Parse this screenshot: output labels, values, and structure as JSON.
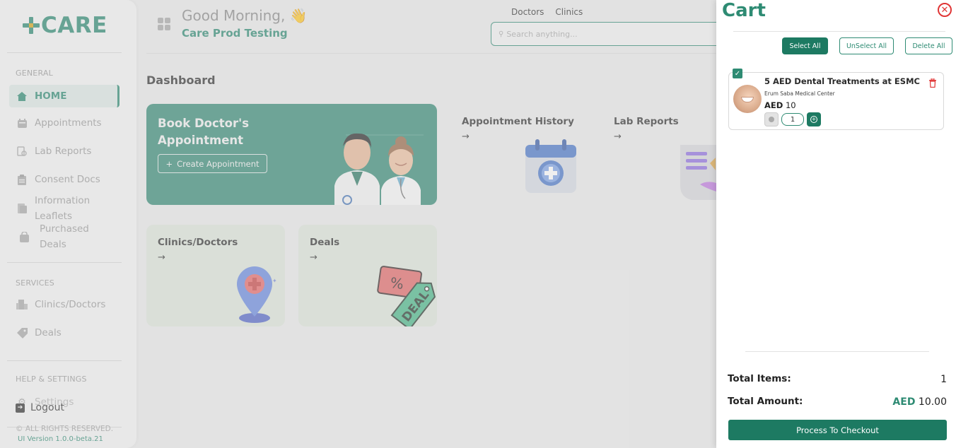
{
  "sidebar": {
    "logo_text": "CARE",
    "general_title": "GENERAL",
    "items": [
      {
        "label": "HOME",
        "icon": "home-icon"
      },
      {
        "label": "Appointments",
        "icon": "calendar-icon"
      },
      {
        "label": "Lab Reports",
        "icon": "lab-icon"
      },
      {
        "label": "Consent Docs",
        "icon": "clipboard-icon"
      },
      {
        "label": "Information",
        "label2": "Leaflets",
        "icon": "document-icon"
      },
      {
        "label": "Purchased",
        "label2": "Deals",
        "icon": "bag-icon"
      }
    ],
    "services_title": "SERVICES",
    "services": [
      {
        "label": "Clinics/Doctors",
        "icon": "building-icon"
      },
      {
        "label": "Deals",
        "icon": "tag-icon"
      }
    ],
    "help_title": "HELP & SETTINGS",
    "settings_label": "Settings",
    "logout_label": "Logout",
    "rights": "© ALL RIGHTS RESERVED.",
    "version": "UI Version 1.0.0-beta.21"
  },
  "header": {
    "greeting": "Good Morning,",
    "greeting_emoji": "👋",
    "user": "Care Prod Testing",
    "links": [
      "Doctors",
      "Clinics"
    ],
    "search_placeholder": "Search anything..."
  },
  "dashboard": {
    "title": "Dashboard",
    "book": {
      "title": "Book Doctor's Appointment",
      "button": "Create Appointment"
    },
    "cards": [
      {
        "title": "Appointment History",
        "arrow": "→"
      },
      {
        "title": "Lab Reports",
        "arrow": "→"
      },
      {
        "title": "Clinics/Doctors",
        "arrow": "→"
      },
      {
        "title": "Deals",
        "arrow": "→"
      }
    ],
    "deal_tag": "DEAL",
    "percent_tag": "%"
  },
  "cart": {
    "title": "Cart",
    "select_all": "Select All",
    "unselect_all": "UnSelect All",
    "delete_all": "Delete All",
    "item": {
      "name": "5 AED Dental Treatments at ESMC",
      "clinic": "Erum Saba Medical Center",
      "currency": "AED",
      "price": "10",
      "qty": "1"
    },
    "total_items_label": "Total Items:",
    "total_items": "1",
    "total_amount_label": "Total Amount:",
    "total_currency": "AED",
    "total_amount": "10.00",
    "checkout_label": "Process To Checkout"
  },
  "colors": {
    "brand": "#2e8b73",
    "accent": "#d9a51a",
    "danger": "#e03535"
  }
}
